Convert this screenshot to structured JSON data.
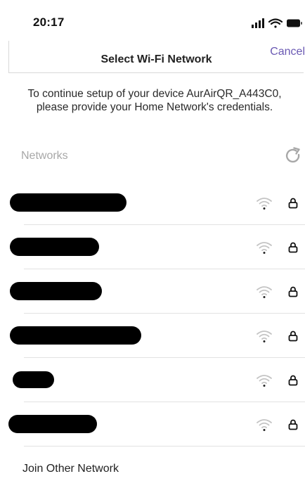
{
  "status_bar": {
    "time": "20:17",
    "icons": [
      "signal-icon",
      "wifi-icon",
      "battery-icon"
    ]
  },
  "nav": {
    "title": "Select Wi-Fi Network",
    "cancel_label": "Cancel"
  },
  "intro_text": "To continue setup of your device AurAirQR_A443C0, please provide your Home Network's credentials.",
  "networks": {
    "section_label": "Networks",
    "items": [
      {
        "name_redacted": true,
        "secured": true,
        "signal_icon": "wifi-icon"
      },
      {
        "name_redacted": true,
        "secured": true,
        "signal_icon": "wifi-icon"
      },
      {
        "name_redacted": true,
        "secured": true,
        "signal_icon": "wifi-icon"
      },
      {
        "name_redacted": true,
        "secured": true,
        "signal_icon": "wifi-icon"
      },
      {
        "name_redacted": true,
        "secured": true,
        "signal_icon": "wifi-icon"
      },
      {
        "name_redacted": true,
        "secured": true,
        "signal_icon": "wifi-icon"
      }
    ]
  },
  "join_other_label": "Join Other Network",
  "colors": {
    "accent": "#6a59b3",
    "muted_text": "#a8a8a8",
    "icon_gray": "#c4c4c4",
    "divider": "#e2e2e2"
  }
}
